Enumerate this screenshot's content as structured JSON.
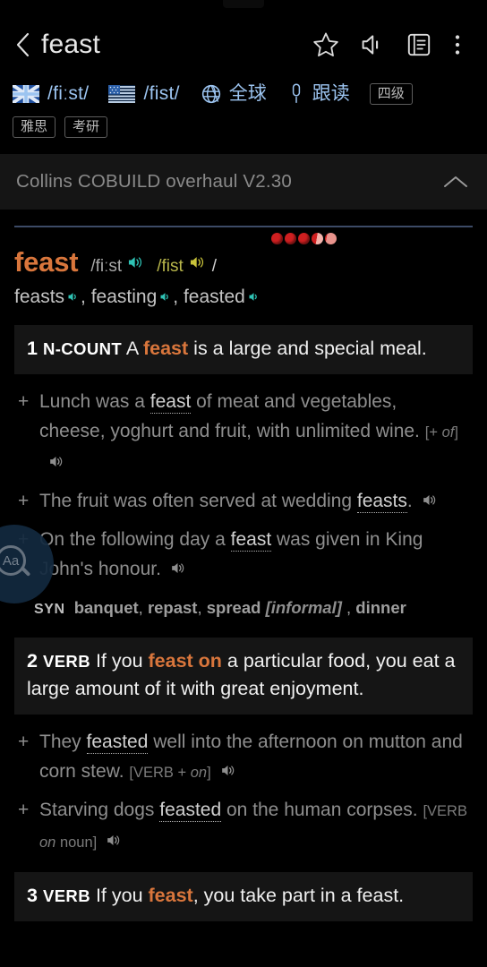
{
  "app": {
    "back_icon": "chevron-left-icon",
    "title": "feast",
    "actions": [
      {
        "name": "favorite-star-icon",
        "label": "star"
      },
      {
        "name": "speaker-icon",
        "label": "pronounce"
      },
      {
        "name": "notebook-icon",
        "label": "wordbook"
      },
      {
        "name": "overflow-menu-icon",
        "label": "more"
      }
    ]
  },
  "pronunciation": {
    "uk_flag": "uk-flag-icon",
    "uk_phonetic": "/fiːst/",
    "us_flag": "us-flag-icon",
    "us_phonetic": "/fist/",
    "globe_icon": "globe-icon",
    "global_label": "全球",
    "mic_icon": "microphone-icon",
    "follow_read_label": "跟读",
    "badges": [
      "四级",
      "雅思",
      "考研"
    ]
  },
  "collins": {
    "title": "Collins COBUILD overhaul V2.30",
    "collapse_icon": "chevron-up-icon"
  },
  "entry": {
    "headword": "feast",
    "uk_phonetic": "/fiːst",
    "us_phonetic": "/fist",
    "phon_close": "/",
    "star_rating": 5,
    "stars": [
      "full",
      "full",
      "full",
      "half",
      "empty"
    ],
    "inflections": [
      "feasts",
      "feasting",
      "feasted"
    ],
    "inflection_sep": ", "
  },
  "senses": [
    {
      "num": "1",
      "pos": "N-COUNT",
      "def_parts": [
        {
          "t": "A ",
          "k": false
        },
        {
          "t": "feast",
          "k": true
        },
        {
          "t": " is a large and special meal.",
          "k": false
        }
      ],
      "examples": [
        {
          "parts": [
            {
              "t": "Lunch was a ",
              "h": false
            },
            {
              "t": "feast",
              "h": true
            },
            {
              "t": " of meat and vegetables, cheese, yoghurt and fruit, with unlimited wine.",
              "h": false
            }
          ],
          "gram": "[+ of]",
          "gram_italic": "of",
          "speaker": true
        },
        {
          "parts": [
            {
              "t": "The fruit was often served at wedding ",
              "h": false
            },
            {
              "t": "feasts",
              "h": true
            },
            {
              "t": ".",
              "h": false
            }
          ],
          "gram": "",
          "speaker": true
        },
        {
          "parts": [
            {
              "t": "On the following day a ",
              "h": false
            },
            {
              "t": "feast",
              "h": true
            },
            {
              "t": " was given in King John's honour.",
              "h": false
            }
          ],
          "gram": "",
          "speaker": true
        }
      ],
      "syn_label": "SYN",
      "synonyms": "banquet, repast, spread [informal] , dinner"
    },
    {
      "num": "2",
      "pos": "VERB",
      "def_parts": [
        {
          "t": "If you ",
          "k": false
        },
        {
          "t": "feast on",
          "k": true
        },
        {
          "t": " a particular food, you eat a large amount of it with great enjoyment.",
          "k": false
        }
      ],
      "examples": [
        {
          "parts": [
            {
              "t": "They ",
              "h": false
            },
            {
              "t": "feasted",
              "h": true
            },
            {
              "t": " well into the afternoon on mutton and corn stew.",
              "h": false
            }
          ],
          "gram": "[VERB + on]",
          "speaker": true
        },
        {
          "parts": [
            {
              "t": "Starving dogs ",
              "h": false
            },
            {
              "t": "feasted",
              "h": true
            },
            {
              "t": " on the human corpses.",
              "h": false
            }
          ],
          "gram": "[VERB on noun]",
          "speaker": true
        }
      ]
    },
    {
      "num": "3",
      "pos": "VERB",
      "def_parts": [
        {
          "t": "If you ",
          "k": false
        },
        {
          "t": "feast",
          "k": true
        },
        {
          "t": ", you take part in a feast.",
          "k": false
        }
      ],
      "examples": []
    }
  ],
  "fab": {
    "icon": "font-size-magnifier-icon",
    "label": "Aa"
  },
  "colors": {
    "accent_orange": "#d9763c",
    "link_blue": "#9cc4f0",
    "rating_red": "#cf1f20",
    "us_phonetic": "#b9b74b",
    "speaker_cyan": "#2fc3b5",
    "speaker_yellow": "#c9c33a"
  }
}
